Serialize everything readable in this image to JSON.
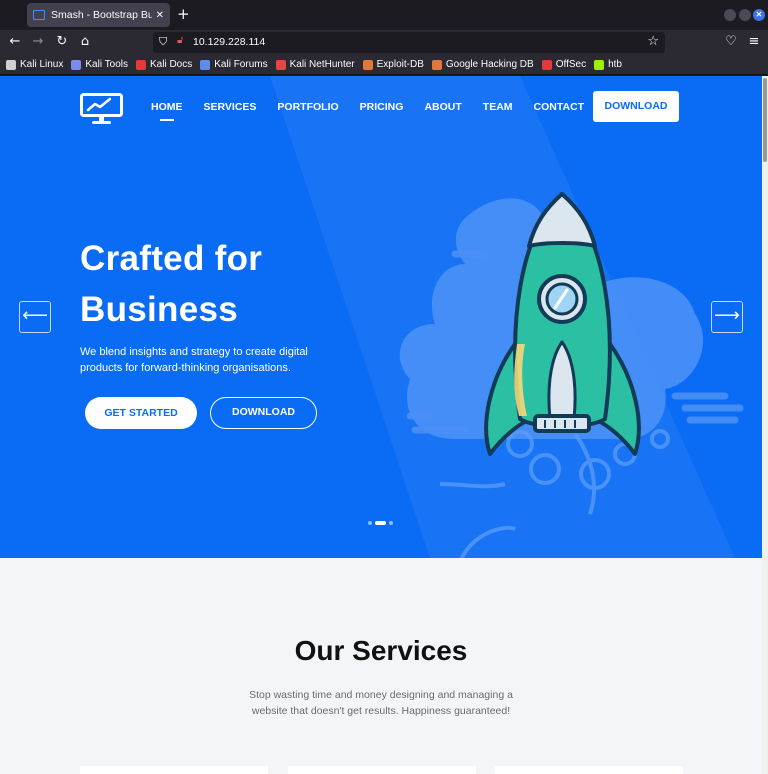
{
  "browser": {
    "tab_title": "Smash - Bootstrap Business",
    "tab_close": "✕",
    "new_tab": "+",
    "url": "10.129.228.114",
    "bookmarks": [
      {
        "label": "Kali Linux",
        "icon": "kali-dragon-icon",
        "color": "#d0d0d0"
      },
      {
        "label": "Kali Tools",
        "icon": "kali-tools-icon",
        "color": "#7b8cf0"
      },
      {
        "label": "Kali Docs",
        "icon": "kali-docs-icon",
        "color": "#e03b3b"
      },
      {
        "label": "Kali Forums",
        "icon": "kali-forums-icon",
        "color": "#5d8de8"
      },
      {
        "label": "Kali NetHunter",
        "icon": "nethunter-icon",
        "color": "#e04848"
      },
      {
        "label": "Exploit-DB",
        "icon": "exploit-db-icon",
        "color": "#e0783b"
      },
      {
        "label": "Google Hacking DB",
        "icon": "ghdb-icon",
        "color": "#e0783b"
      },
      {
        "label": "OffSec",
        "icon": "offsec-icon",
        "color": "#e03b3b"
      },
      {
        "label": "htb",
        "icon": "htb-cube-icon",
        "color": "#9fef00"
      }
    ]
  },
  "site": {
    "nav": {
      "items": [
        "HOME",
        "SERVICES",
        "PORTFOLIO",
        "PRICING",
        "ABOUT",
        "TEAM",
        "CONTACT"
      ],
      "active": "HOME",
      "download_label": "DOWNLOAD"
    },
    "hero": {
      "title_line1": "Crafted for",
      "title_line2": "Business",
      "description": "We blend insights and strategy to create digital products for forward-thinking organisations.",
      "primary_button": "GET STARTED",
      "secondary_button": "DOWNLOAD",
      "prev_arrow": "⟵",
      "next_arrow": "⟶",
      "slides": 3,
      "active_slide": 2
    },
    "services": {
      "title": "Our Services",
      "description": "Stop wasting time and money designing and managing a website that doesn't get results. Happiness guaranteed!"
    }
  },
  "colors": {
    "brand_blue": "#0a6cf5",
    "rocket_teal": "#2bbfa4",
    "rocket_outline": "#123b57"
  }
}
